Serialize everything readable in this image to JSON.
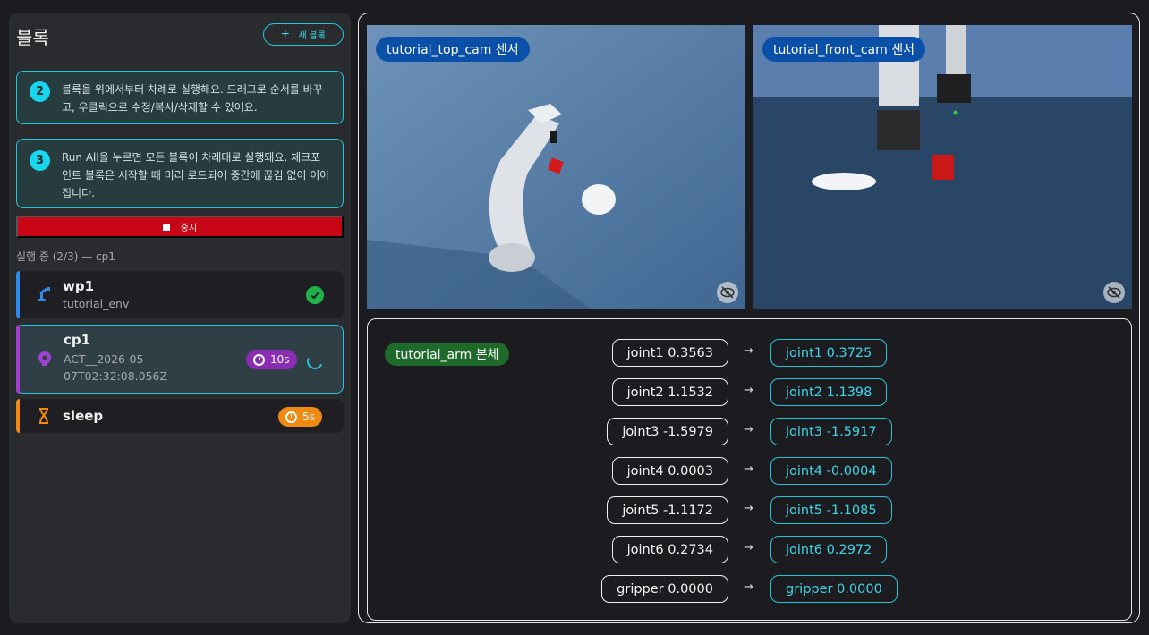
{
  "sidebar": {
    "title": "블록",
    "new_block_label": "새 블록",
    "tips": [
      {
        "num": "2",
        "text": "블록을 위에서부터 차례로 실행해요. 드래그로 순서를 바꾸고, 우클릭으로 수정/복사/삭제할 수 있어요."
      },
      {
        "num": "3",
        "text": "Run All을 누르면 모든 블록이 차례대로 실행돼요. 체크포인트 블록은 시작할 때 미리 로드되어 중간에 끊김 없이 이어집니다."
      }
    ],
    "stop_label": "중지",
    "status": "실행 중 (2/3) — cp1",
    "blocks": [
      {
        "name": "wp1",
        "sub": "tutorial_env",
        "icon": "robot-arm-icon",
        "color": "#2e8ae6",
        "state": "done"
      },
      {
        "name": "cp1",
        "sub": "ACT__2026-05-07T02:32:08.056Z",
        "icon": "brain-icon",
        "color": "#a040d0",
        "timer": "10s",
        "state": "running"
      },
      {
        "name": "sleep",
        "sub": "",
        "icon": "hourglass-icon",
        "color": "#f08a12",
        "timer": "5s",
        "state": "pending"
      }
    ]
  },
  "cameras": [
    {
      "label": "tutorial_top_cam 센서"
    },
    {
      "label": "tutorial_front_cam 센서"
    }
  ],
  "robot": {
    "tag": "tutorial_arm 본체",
    "joints": [
      {
        "current": "joint1 0.3563",
        "target": "joint1 0.3725"
      },
      {
        "current": "joint2 1.1532",
        "target": "joint2 1.1398"
      },
      {
        "current": "joint3 -1.5979",
        "target": "joint3 -1.5917"
      },
      {
        "current": "joint4 0.0003",
        "target": "joint4 -0.0004"
      },
      {
        "current": "joint5 -1.1172",
        "target": "joint5 -1.1085"
      },
      {
        "current": "joint6 0.2734",
        "target": "joint6 0.2972"
      },
      {
        "current": "gripper 0.0000",
        "target": "gripper 0.0000"
      }
    ]
  }
}
